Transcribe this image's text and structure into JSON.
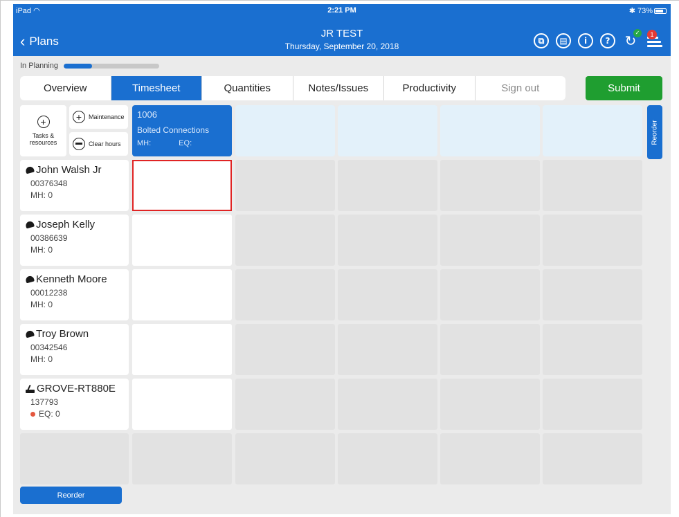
{
  "status_bar": {
    "device": "iPad",
    "time": "2:21 PM",
    "battery": "73%"
  },
  "nav": {
    "back_label": "Plans",
    "title": "JR TEST",
    "subtitle": "Thursday, September 20, 2018",
    "notification_count": "1",
    "icons": [
      "copy-icon",
      "trash-icon",
      "info-icon",
      "help-icon",
      "sync-icon",
      "menu-icon"
    ]
  },
  "progress": {
    "label": "In Planning",
    "fraction": 0.3
  },
  "tabs": [
    "Overview",
    "Timesheet",
    "Quantities",
    "Notes/Issues",
    "Productivity",
    "Sign out"
  ],
  "active_tab": "Timesheet",
  "submit_label": "Submit",
  "toolbar": {
    "tasks_label": "Tasks & resources",
    "maintenance_label": "Maintenance",
    "clear_label": "Clear hours"
  },
  "task": {
    "number": "1006",
    "name": "Bolted Connections",
    "mh_label": "MH:",
    "eq_label": "EQ:"
  },
  "reorder_side_label": "Reorder",
  "reorder_bottom_label": "Reorder",
  "resources": [
    {
      "name": "John Walsh Jr",
      "id": "00376348",
      "hours": "MH:  0",
      "type": "person"
    },
    {
      "name": "Joseph Kelly",
      "id": "00386639",
      "hours": "MH:  0",
      "type": "person"
    },
    {
      "name": "Kenneth Moore",
      "id": "00012238",
      "hours": "MH:  0",
      "type": "person"
    },
    {
      "name": "Troy Brown",
      "id": "00342546",
      "hours": "MH:  0",
      "type": "person"
    },
    {
      "name": "GROVE-RT880E",
      "id": "137793",
      "hours": "EQ:  0",
      "type": "equipment"
    }
  ],
  "colors": {
    "primary": "#1a6fd0",
    "submit": "#1f9e30",
    "selected_border": "#e02424",
    "header_empty": "#e3f1fa"
  }
}
